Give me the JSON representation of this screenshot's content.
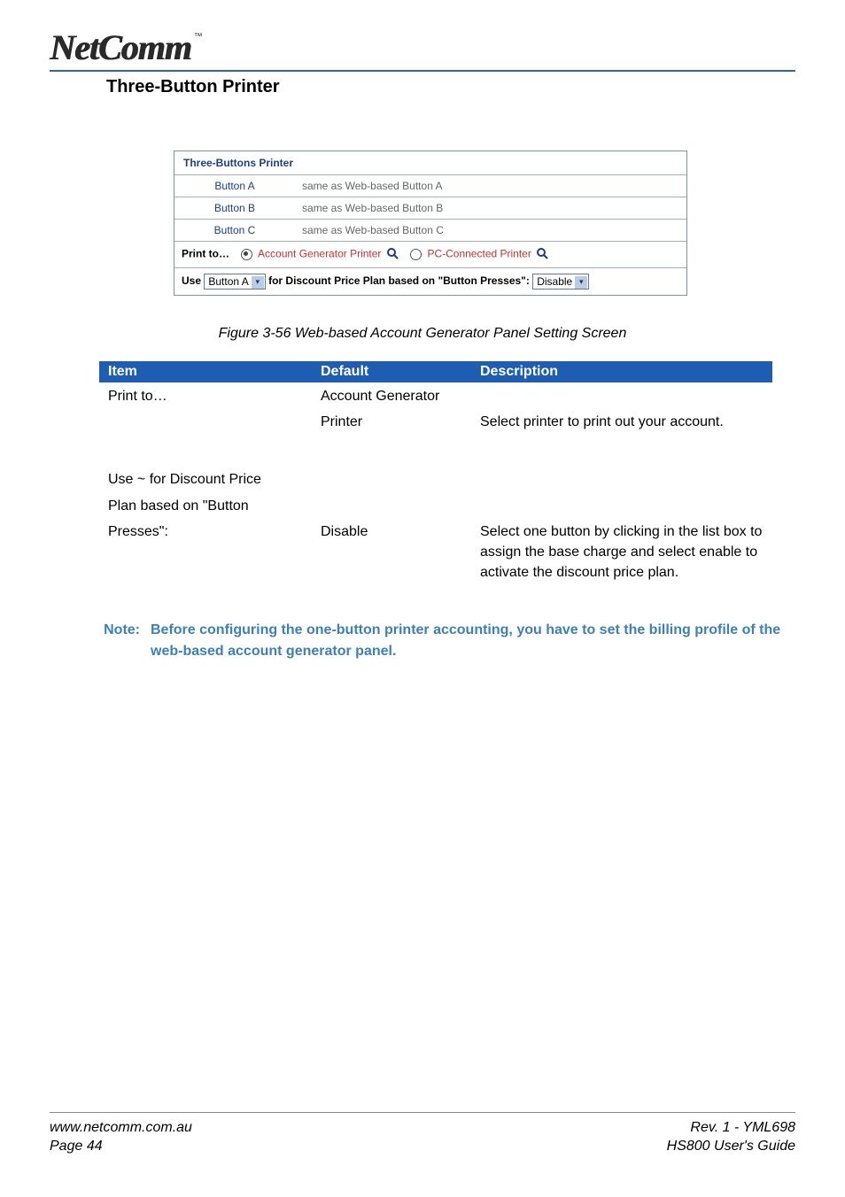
{
  "brand": {
    "logo_text": "NetComm",
    "tm": "™"
  },
  "section_title": "Three-Button Printer",
  "figure": {
    "panel_title": "Three-Buttons Printer",
    "rows": [
      {
        "label": "Button A",
        "value": "same as Web-based Button A"
      },
      {
        "label": "Button B",
        "value": "same as Web-based Button B"
      },
      {
        "label": "Button C",
        "value": "same as Web-based Button C"
      }
    ],
    "printto": {
      "label": "Print to…",
      "option_a": "Account Generator Printer",
      "option_b": "PC-Connected Printer"
    },
    "use_row": {
      "prefix": "Use",
      "combo1": "Button A",
      "middle": "for Discount Price Plan based on \"Button Presses\":",
      "combo2": "Disable"
    }
  },
  "figure_caption": "Figure 3-56 Web-based Account Generator Panel Setting Screen",
  "table": {
    "headers": {
      "item": "Item",
      "def": "Default",
      "desc": "Description"
    },
    "row1": {
      "item": "Print to…",
      "def_line1": "Account Generator",
      "def_line2": "Printer",
      "desc": "Select printer to print out your account."
    },
    "row2": {
      "item_line1": "Use ~ for Discount Price",
      "item_line2": "Plan based on \"Button",
      "item_line3": "Presses\":",
      "def": "Disable",
      "desc": "Select one button by clicking in the list box to assign the base charge and select enable to activate the discount price plan."
    }
  },
  "note": {
    "label": "Note:",
    "body": "Before configuring the one-button printer accounting, you have to set the billing profile of the web-based account generator panel."
  },
  "footer": {
    "left1": "www.netcomm.com.au",
    "right1": "Rev. 1 - YML698",
    "left2": "Page 44",
    "right2": "HS800 User's Guide"
  }
}
